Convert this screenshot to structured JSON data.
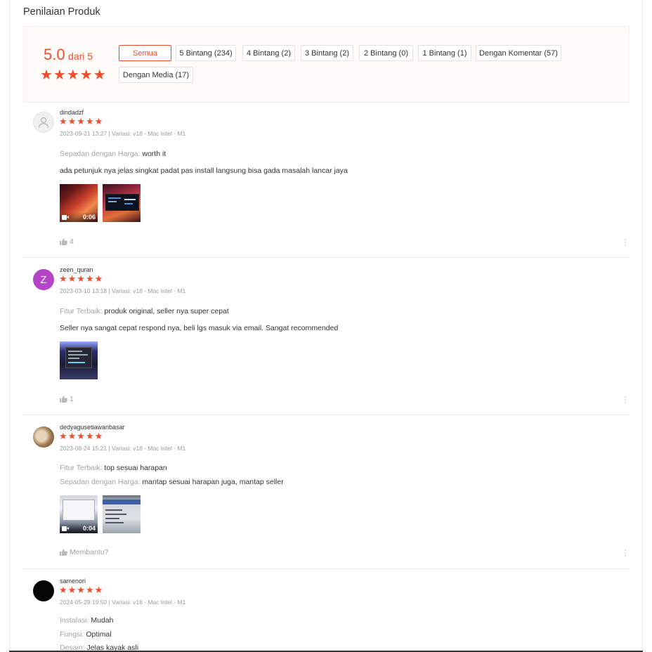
{
  "section_title": "Penilaian Produk",
  "summary": {
    "score": "5.0",
    "score_suffix": "dari 5",
    "stars": "★★★★★",
    "filters": [
      "Semua",
      "5 Bintang (234)",
      "4 Bintang (2)",
      "3 Bintang (2)",
      "2 Bintang (0)",
      "1 Bintang (1)",
      "Dengan Komentar (57)",
      "Dengan Media (17)"
    ]
  },
  "colors": {
    "accent": "#ee4d2d",
    "label_gray": "#a3a3a3",
    "summary_bg": "#fffbf8"
  },
  "reviews": [
    {
      "username": "dindadzf",
      "stars": "★★★★★",
      "meta": "2023-09-21 13:27 | Variasi: v18 - Mac Intel - M1",
      "lines": [
        {
          "label": "Sepadan dengan Harga:",
          "value": " worth it"
        },
        {
          "label": "",
          "value": "ada petunjuk nya jelas singkat padat pas install langsung bisa gada masalah lancar jaya"
        }
      ],
      "video_duration": "0:06",
      "likes": "4",
      "avatar": "default-avatar-icon"
    },
    {
      "username": "zeen_quran",
      "avatar_letter": "Z",
      "stars": "★★★★★",
      "meta": "2023-03-10 13:18 | Variasi: v18 - Mac Intel - M1",
      "lines": [
        {
          "label": "Fitur Terbaik:",
          "value": " produk original, seller nya super cepat"
        },
        {
          "label": "",
          "value": "Seller nya sangat cepat respond nya, beli lgs masuk via email. Sangat recommended"
        }
      ],
      "likes": "1"
    },
    {
      "username": "dedyagusetiawanbasar",
      "stars": "★★★★★",
      "meta": "2023-08-24 15:21 | Variasi: v18 - Mac Intel - M1",
      "lines": [
        {
          "label": "Fitur Terbaik:",
          "value": " top sesuai harapan"
        },
        {
          "label": "Sepadan dengan Harga:",
          "value": " mantap sesuai harapan juga, mantap seller"
        }
      ],
      "video_duration": "0:04",
      "likes": "Membantu?"
    },
    {
      "username": "samenori",
      "stars": "★★★★★",
      "meta": "2024-05-29 19:50 | Variasi: v18 - Mac Intel - M1",
      "lines": [
        {
          "label": "Instalasi:",
          "value": " Mudah"
        },
        {
          "label": "Fungsi:",
          "value": " Optimal"
        },
        {
          "label": "Desain:",
          "value": " Jelas kayak asli"
        }
      ]
    }
  ],
  "more_icon": "⋮"
}
